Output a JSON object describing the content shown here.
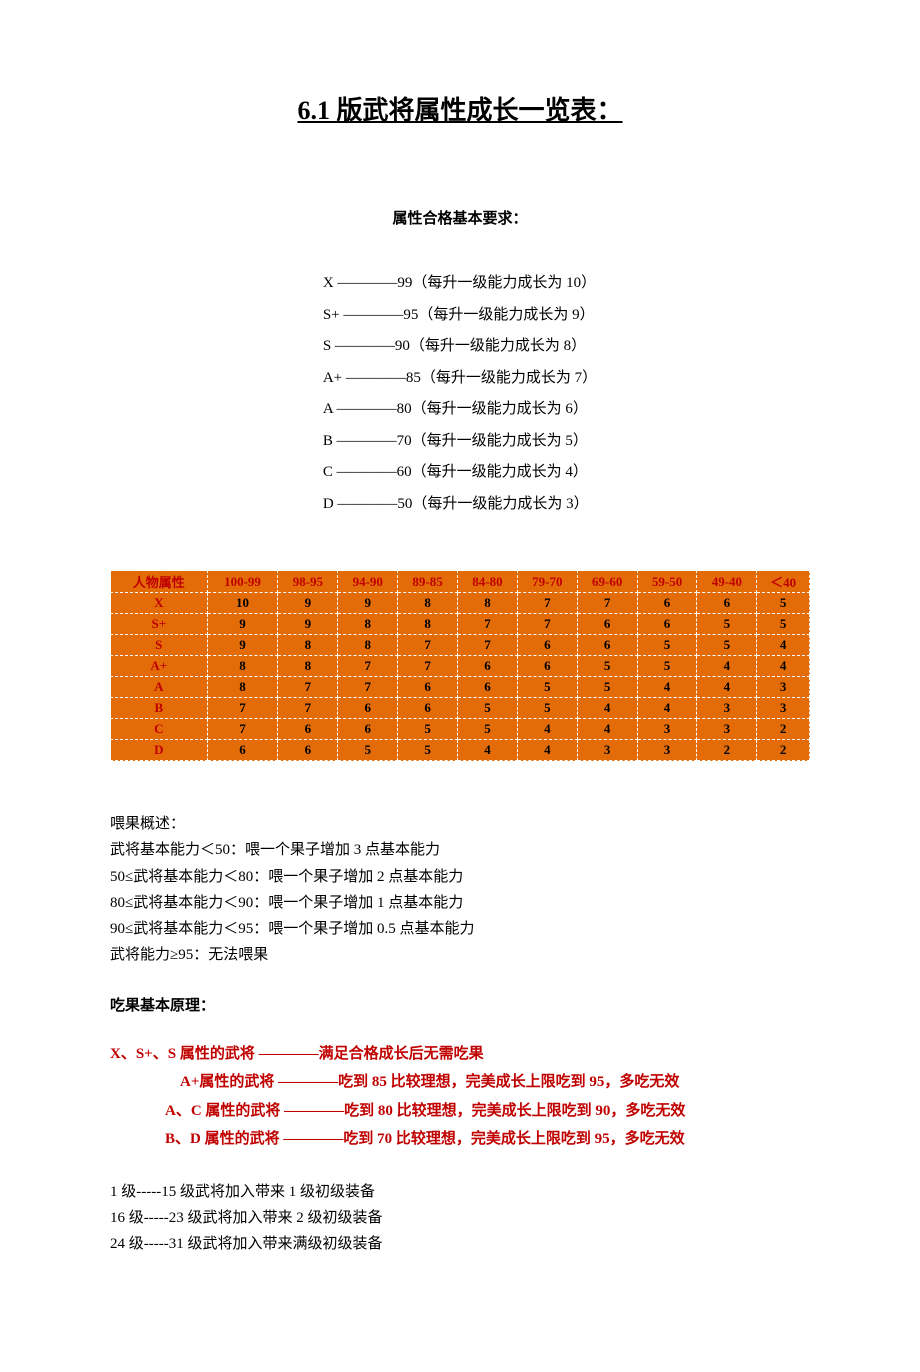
{
  "title": "6.1 版武将属性成长一览表：",
  "subtitle": "属性合格基本要求：",
  "requirements": [
    "X ————99（每升一级能力成长为 10）",
    "S+ ————95（每升一级能力成长为 9）",
    "S ————90（每升一级能力成长为 8）",
    "A+ ————85（每升一级能力成长为 7）",
    "A ————80（每升一级能力成长为 6）",
    "B ————70（每升一级能力成长为 5）",
    "C ————60（每升一级能力成长为 4）",
    "D ————50（每升一级能力成长为 3）"
  ],
  "chart_data": {
    "type": "table",
    "headers": [
      "人物属性",
      "100-99",
      "98-95",
      "94-90",
      "89-85",
      "84-80",
      "79-70",
      "69-60",
      "59-50",
      "49-40",
      "＜40"
    ],
    "rows": [
      {
        "label": "X",
        "values": [
          10,
          9,
          9,
          8,
          8,
          7,
          7,
          6,
          6,
          5
        ]
      },
      {
        "label": "S+",
        "values": [
          9,
          9,
          8,
          8,
          7,
          7,
          6,
          6,
          5,
          5
        ]
      },
      {
        "label": "S",
        "values": [
          9,
          8,
          8,
          7,
          7,
          6,
          6,
          5,
          5,
          4
        ]
      },
      {
        "label": "A+",
        "values": [
          8,
          8,
          7,
          7,
          6,
          6,
          5,
          5,
          4,
          4
        ]
      },
      {
        "label": "A",
        "values": [
          8,
          7,
          7,
          6,
          6,
          5,
          5,
          4,
          4,
          3
        ]
      },
      {
        "label": "B",
        "values": [
          7,
          7,
          6,
          6,
          5,
          5,
          4,
          4,
          3,
          3
        ]
      },
      {
        "label": "C",
        "values": [
          7,
          6,
          6,
          5,
          5,
          4,
          4,
          3,
          3,
          2
        ]
      },
      {
        "label": "D",
        "values": [
          6,
          6,
          5,
          5,
          4,
          4,
          3,
          3,
          2,
          2
        ]
      }
    ]
  },
  "fruit_heading": "喂果概述：",
  "fruit_lines": [
    "武将基本能力＜50：喂一个果子增加 3 点基本能力",
    "50≤武将基本能力＜80：喂一个果子增加 2 点基本能力",
    "80≤武将基本能力＜90：喂一个果子增加 1 点基本能力",
    "90≤武将基本能力＜95：喂一个果子增加 0.5 点基本能力",
    "武将能力≥95：无法喂果"
  ],
  "eat_heading": "吃果基本原理：",
  "eat_lines": [
    "X、S+、S 属性的武将 ————满足合格成长后无需吃果",
    "A+属性的武将 ————吃到 85 比较理想，完美成长上限吃到 95，多吃无效",
    "A、C 属性的武将 ————吃到 80 比较理想，完美成长上限吃到 90，多吃无效",
    "B、D 属性的武将 ————吃到 70 比较理想，完美成长上限吃到 95，多吃无效"
  ],
  "equip_lines": [
    "1 级-----15 级武将加入带来 1 级初级装备",
    "16 级-----23 级武将加入带来 2 级初级装备",
    "24 级-----31 级武将加入带来满级初级装备"
  ]
}
